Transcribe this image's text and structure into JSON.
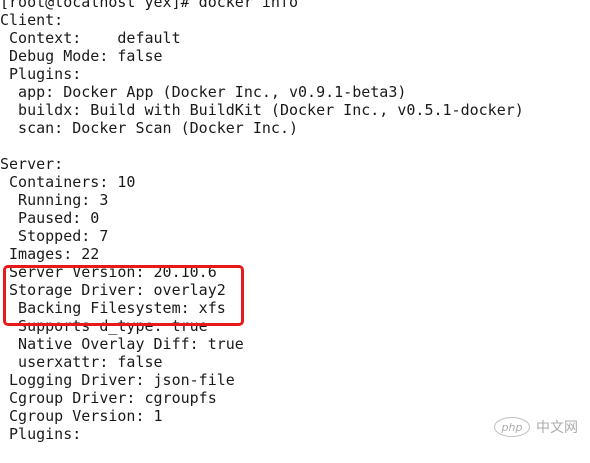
{
  "terminal": {
    "lines": [
      "[root@localhost yex]# docker info",
      "Client:",
      " Context:    default",
      " Debug Mode: false",
      " Plugins:",
      "  app: Docker App (Docker Inc., v0.9.1-beta3)",
      "  buildx: Build with BuildKit (Docker Inc., v0.5.1-docker)",
      "  scan: Docker Scan (Docker Inc.)",
      "",
      "Server:",
      " Containers: 10",
      "  Running: 3",
      "  Paused: 0",
      "  Stopped: 7",
      " Images: 22",
      " Server Version: 20.10.6",
      " Storage Driver: overlay2",
      "  Backing Filesystem: xfs",
      "  Supports d_type: true",
      "  Native Overlay Diff: true",
      "  userxattr: false",
      " Logging Driver: json-file",
      " Cgroup Driver: cgroupfs",
      " Cgroup Version: 1",
      " Plugins:"
    ]
  },
  "watermark": {
    "logo_text": "php",
    "site_text": "中文网"
  },
  "colors": {
    "highlight_border": "#e8191b",
    "terminal_text": "#1a1a1a",
    "background": "#ffffff"
  }
}
